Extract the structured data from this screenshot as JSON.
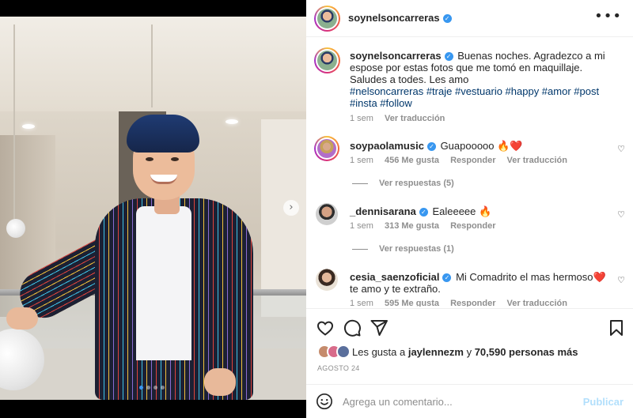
{
  "header": {
    "username": "soynelsoncarreras",
    "more_icon": "more-horizontal-icon"
  },
  "caption": {
    "username": "soynelsoncarreras",
    "text_line1": "Buenas noches. Agradezco a mi espose por estas fotos que me tomó en maquillaje.",
    "text_line2": "Saludes a todes. Les amo",
    "hashtags": "#nelsoncarreras #traje #vestuario #happy #amor #post #insta #follow",
    "time": "1 sem",
    "translate": "Ver traducción"
  },
  "comments": [
    {
      "username": "soypaolamusic",
      "text": "Guapooooo 🔥❤️",
      "time": "1 sem",
      "likes": "456 Me gusta",
      "reply": "Responder",
      "translate": "Ver traducción",
      "replies": "Ver respuestas (5)"
    },
    {
      "username": "_dennisarana",
      "text": "Ealeeeee 🔥",
      "time": "1 sem",
      "likes": "313 Me gusta",
      "reply": "Responder",
      "replies": "Ver respuestas (1)"
    },
    {
      "username": "cesia_saenzoficial",
      "text": "Mi Comadrito el mas hermoso❤️ te amo y te extraño.",
      "time": "1 sem",
      "likes": "595 Me gusta",
      "reply": "Responder",
      "translate": "Ver traducción"
    }
  ],
  "likes": {
    "prefix": "Les gusta a",
    "user": "jaylennezm",
    "connector": "y",
    "count": "70,590 personas más"
  },
  "date": "AGOSTO 24",
  "add_comment": {
    "placeholder": "Agrega un comentario...",
    "publish": "Publicar"
  },
  "carousel": {
    "next_glyph": "›",
    "slide_count": 4,
    "active_slide": 1
  },
  "colors": {
    "link": "#00376b",
    "verified": "#3897f0",
    "muted": "#8e8e8e",
    "publish_disabled": "#b2dffc",
    "heart_red": "#ed4956"
  }
}
